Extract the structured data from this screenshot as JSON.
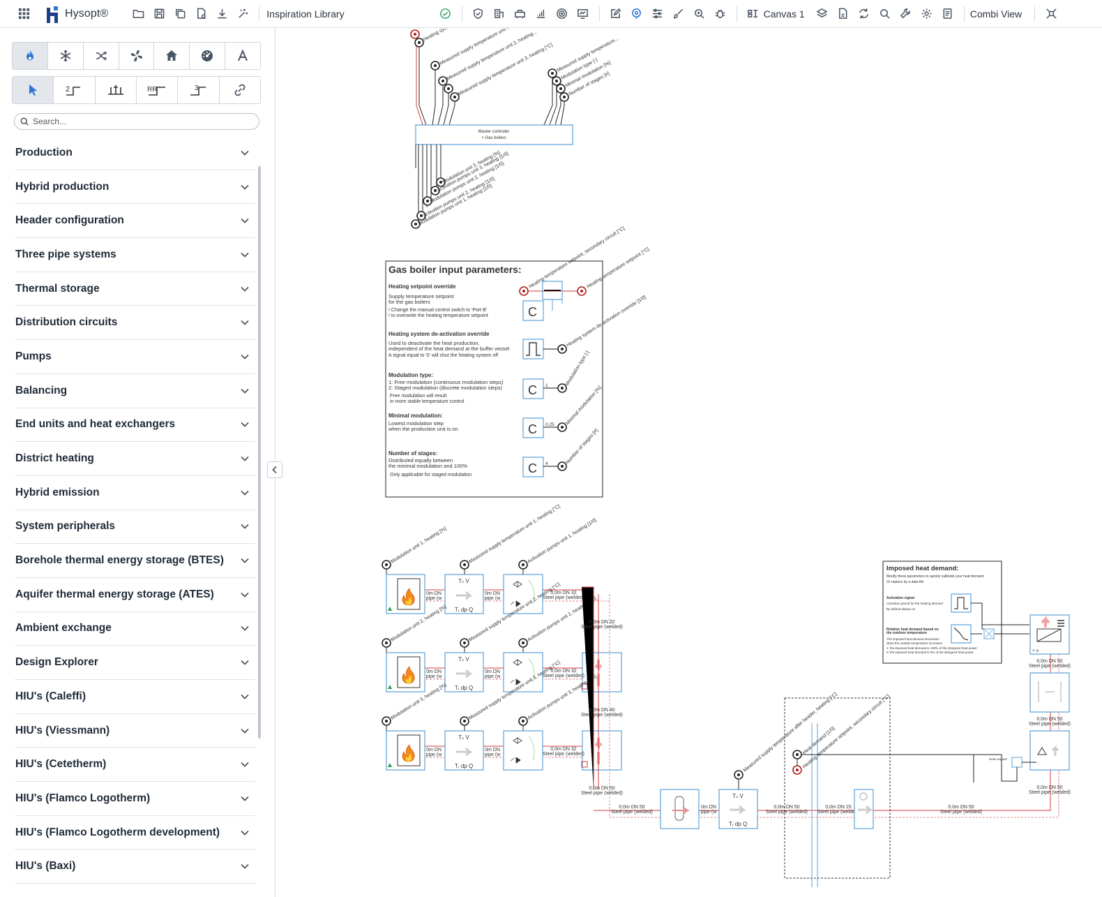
{
  "topbar": {
    "brand": "Hysopt®",
    "library_title": "Inspiration Library",
    "canvas_label": "Canvas 1",
    "view_label": "Combi View"
  },
  "sidebar": {
    "search_placeholder": "Search...",
    "categories": [
      "Production",
      "Hybrid production",
      "Header configuration",
      "Three pipe systems",
      "Thermal storage",
      "Distribution circuits",
      "Pumps",
      "Balancing",
      "End units and heat exchangers",
      "District heating",
      "Hybrid emission",
      "System peripherals",
      "Borehole thermal energy storage (BTES)",
      "Aquifer thermal energy storage (ATES)",
      "Ambient exchange",
      "Design Explorer",
      "HIU's (Caleffi)",
      "HIU's (Viessmann)",
      "HIU's (Cetetherm)",
      "HIU's (Flamco Logotherm)",
      "HIU's (Flamco Logotherm development)",
      "HIU's (Baxi)"
    ],
    "tool_labels": {
      "t2": "2",
      "rr": "RR",
      "t3": "3"
    }
  },
  "diagram": {
    "top_labels": [
      "Heating system de-activation...",
      "Measured supply temperature unit 1, heating...",
      "Measured supply temperature unit 2, heating...",
      "Measured supply temperature unit 3, heating [°C]",
      "Measured supply temperature...",
      "Modulation type [-]",
      "Minimal modulation [%]",
      "Number of stages [#]"
    ],
    "controller_title": "Master controller",
    "controller_sub": "+ Gas boilers",
    "bottom_labels": [
      "Modulation unit 3, heating [%]",
      "Activation pumps unit 3, heating [1/0]",
      "Modulation pumps unit 2, heating [1/0]",
      "Activation pumps unit 2, heating [1/0]",
      "Modulation pumps unit 1, heating [1/0]"
    ],
    "params": {
      "title": "Gas boiler input parameters:",
      "s1_title": "Heating setpoint override",
      "s1_l1": "Supply temperature setpoint",
      "s1_l2": "for the gas boilers",
      "s1_n1": "! Change the manual control switch to 'Port B'",
      "s1_n2": "! to overwrite the heating temperature setpoint",
      "s2_title": "Heating system de-activation override",
      "s2_l1": "Used to deactivate the heat production,",
      "s2_l2": "independent of the heat demand at the buffer vessel",
      "s2_n1": "A signal equal to '0' will shut the heating system off",
      "s3_title": "Modulation type:",
      "s3_l1": "1: Free modulation (continuous modulation steps)",
      "s3_l2": "2: Staged modulation (discrete modulation steps)",
      "s3_n1": "Free modulation will result",
      "s3_n2": "in more stable temperature control",
      "s4_title": "Minimal modulation:",
      "s4_l1": "Lowest modulation step",
      "s4_l2": "when the production unit is on",
      "s5_title": "Number of stages:",
      "s5_l1": "Distributed equally between",
      "s5_l2": "the minimal modulation and 100%",
      "s5_n1": "Only applicable for staged modulation",
      "c_symbol": "C",
      "v_mod_type": "1",
      "v_min_mod": "0.25",
      "v_stages": "4",
      "out1": "Heating temperature setpoint, secondary circuit [°C]",
      "out2": "Heating temperature setpoint [°C]",
      "out3": "Heating system de-activation override [1/0]",
      "out4": "Modulation type [-]",
      "out5": "Minimal modulation [%]",
      "out6": "Number of stages [#]"
    },
    "boiler_rows": [
      {
        "mod": "Modulation unit 1, heating [%]",
        "temp": "Measured supply temperature unit 1, heating [°C]",
        "pump": "Activation pumps unit 1, heating [1/0]"
      },
      {
        "mod": "Modulation unit 2, heating [%]",
        "temp": "Measured supply temperature unit 2, heating [°C]",
        "pump": "Activation pumps unit 2, heating [1/0]"
      },
      {
        "mod": "Modulation unit 3, heating [%]",
        "temp": "Measured supply temperature unit 3, heating [°C]",
        "pump": "Activation pumps unit 3, heating [1/0]"
      }
    ],
    "pipe_short": "0m DN",
    "pipe_type_short": "pipe (w",
    "pipe_32": "0.0m DN 32",
    "pipe_40": "0.0m DN 40",
    "pipe_50": "0.0m DN 50",
    "pipe_15": "0.0m DN 15",
    "steel_pipe": "Steel pipe (welded)",
    "tv_label": "Tₛ V",
    "tdpq_label": "Tᵣ dp Q",
    "imposed": {
      "title": "Imposed heat demand:",
      "l1": "Modify these parameters to quickly calibrate your heat demand",
      "l2": "Or replace by a data-file",
      "act_title": "Activation signal",
      "act_l1": "Activation period for the heating demand",
      "act_l2": "By default always on",
      "rel_title": "Relative heat demand based on",
      "rel_title2": "the outdoor temperature",
      "rel_l1": "The imposed heat demand decreases",
      "rel_l2": "when the outside temperature increases",
      "rel_n1": "1: the imposed heat demand is 100% of the designed heat power",
      "rel_n2": "0: the imposed heat demand is 0% of the designed heat power"
    },
    "heat_request": "Heat request",
    "hdr_labels": [
      "Measured supply temperature after header, heating [°C]",
      "Heat demand [1/0]",
      "Heating temperature setpoint, secondary circuit [°C]"
    ],
    "mult_symbol": "× n"
  },
  "colors": {
    "supply_pipe": "#d43b3b",
    "return_pipe": "#e98a8a",
    "component_border": "#5aa0d8",
    "signal_wire": "#333333",
    "param_red": "#b01c1c",
    "note_blue": "#3a6e99"
  }
}
